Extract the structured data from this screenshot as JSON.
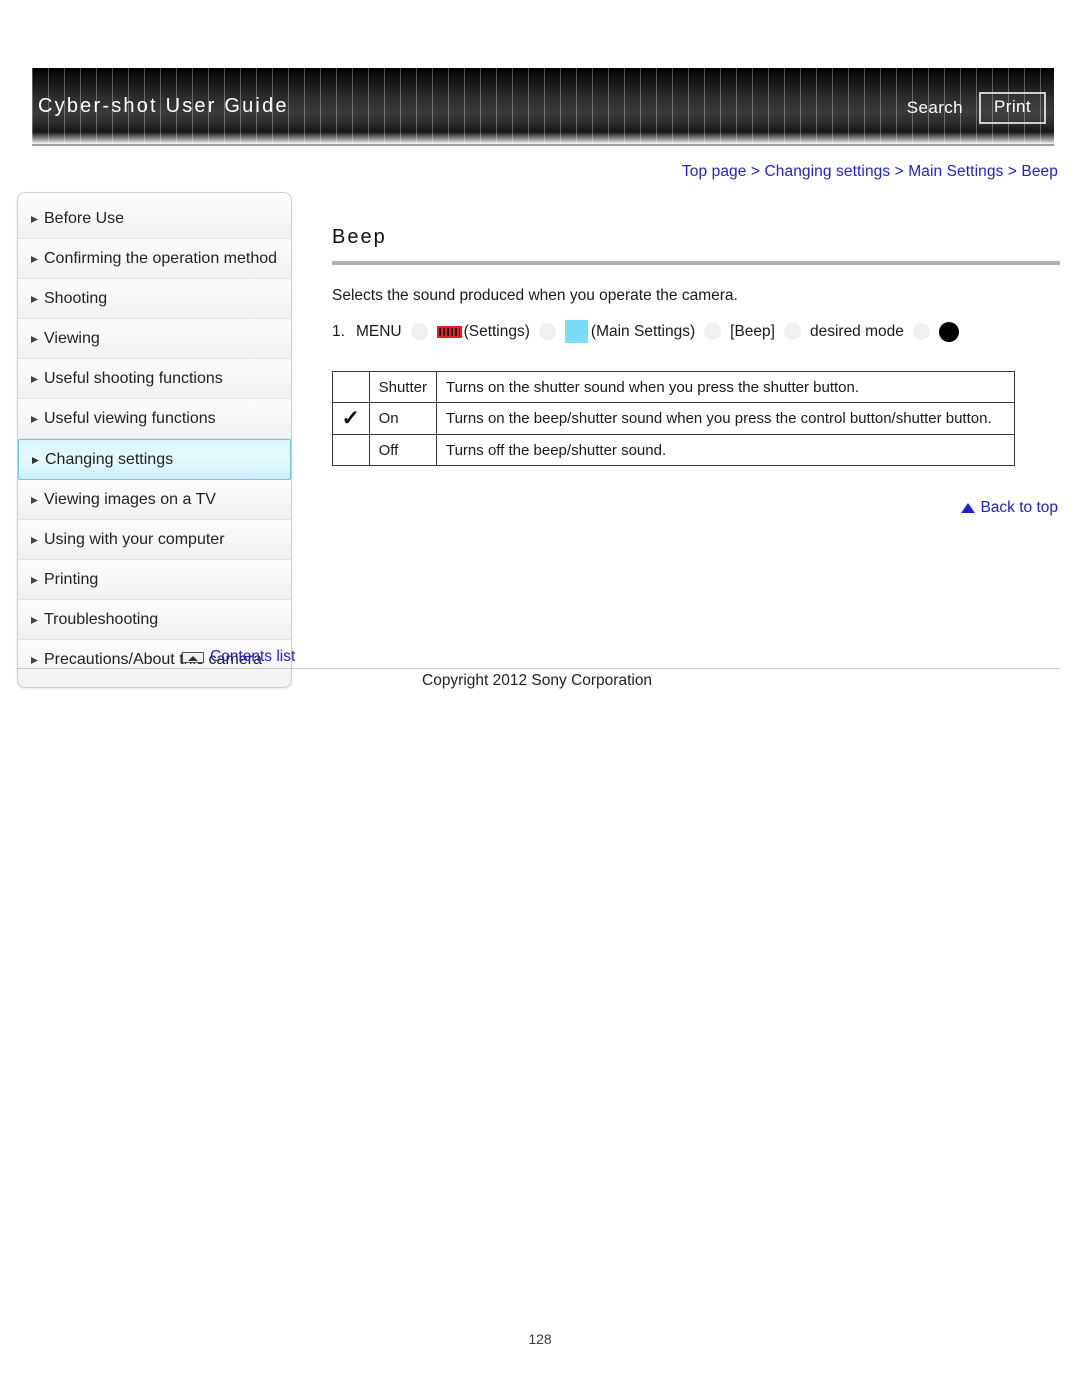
{
  "header": {
    "title": "Cyber-shot User Guide",
    "search_label": "Search",
    "print_label": "Print"
  },
  "breadcrumb": {
    "full": "Top page > Changing settings > Main Settings > Beep",
    "items": [
      "Top page",
      "Changing settings",
      "Main Settings",
      "Beep"
    ],
    "separator": ">",
    "color": "#2222cc"
  },
  "sidebar": {
    "items": [
      {
        "label": "Before Use",
        "active": false
      },
      {
        "label": "Confirming the operation method",
        "active": false
      },
      {
        "label": "Shooting",
        "active": false
      },
      {
        "label": "Viewing",
        "active": false
      },
      {
        "label": "Useful shooting functions",
        "active": false
      },
      {
        "label": "Useful viewing functions",
        "active": false
      },
      {
        "label": "Changing settings",
        "active": true
      },
      {
        "label": "Viewing images on a TV",
        "active": false
      },
      {
        "label": "Using with your computer",
        "active": false
      },
      {
        "label": "Printing",
        "active": false
      },
      {
        "label": "Troubleshooting",
        "active": false
      },
      {
        "label": "Precautions/About this camera",
        "active": false
      }
    ],
    "contents_link": "Contents list",
    "contents_icon": "contents-list-icon",
    "active_color": "#6fc8dd"
  },
  "main": {
    "title": "Beep",
    "intro": "Selects the sound produced when you operate the camera.",
    "step": {
      "number": "1.",
      "menu_label": "MENU",
      "settings_label": "(Settings)",
      "main_settings_label": "(Main Settings)",
      "beep_label": "[Beep]",
      "desired_mode_label": "desired mode",
      "settings_icon": "settings-toolbox-icon",
      "main_settings_icon": "main-settings-icon",
      "end_icon": "black-dot-icon",
      "arrow_icon": "arrow-separator-icon",
      "settings_icon_color": "#ee1c24",
      "main_settings_icon_color": "#7bdcf7"
    },
    "table": {
      "rows": [
        {
          "checked": "",
          "name": "Shutter",
          "description": "Turns on the shutter sound when you press the shutter button."
        },
        {
          "checked": "✓",
          "name": "On",
          "description": "Turns on the beep/shutter sound when you press the control button/shutter button."
        },
        {
          "checked": "",
          "name": "Off",
          "description": "Turns off the beep/shutter sound."
        }
      ]
    },
    "back_to_top": "Back to top"
  },
  "footer": {
    "copyright": "Copyright 2012 Sony Corporation",
    "page_number": "128"
  }
}
